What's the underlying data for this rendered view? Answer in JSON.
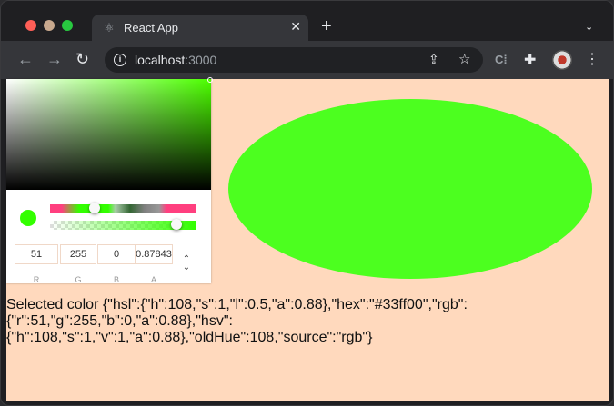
{
  "browser": {
    "tab_title": "React App",
    "tab_close": "✕",
    "new_tab": "+",
    "url_host": "localhost",
    "url_port": ":3000"
  },
  "picker": {
    "fields": {
      "r": "51",
      "g": "255",
      "b": "0",
      "a": "0.87843"
    },
    "labels": {
      "r": "R",
      "g": "G",
      "b": "B",
      "a": "A"
    },
    "hue_position_fraction": 0.3,
    "alpha_value": 0.88
  },
  "ellipse_color": "#4cff1f",
  "output": {
    "text": "Selected color {\"hsl\":{\"h\":108,\"s\":1,\"l\":0.5,\"a\":0.88},\"hex\":\"#33ff00\",\"rgb\":{\"r\":51,\"g\":255,\"b\":0,\"a\":0.88},\"hsv\":{\"h\":108,\"s\":1,\"v\":1,\"a\":0.88},\"oldHue\":108,\"source\":\"rgb\"}"
  }
}
